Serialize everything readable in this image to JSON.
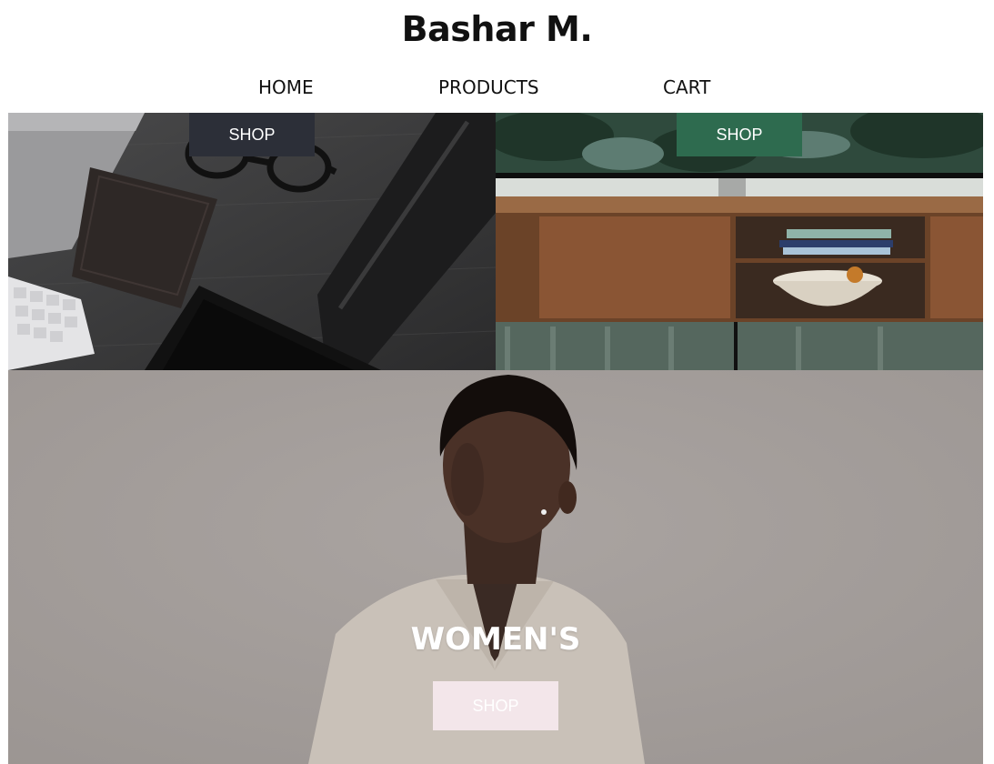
{
  "brand": {
    "name": "Bashar M."
  },
  "nav": {
    "items": [
      "HOME",
      "PRODUCTS",
      "CART"
    ]
  },
  "tiles": {
    "accessories": {
      "button": "SHOP",
      "button_color": "#2c2f38"
    },
    "home": {
      "button": "SHOP",
      "button_color": "#2e6b4f"
    },
    "women": {
      "title": "WOMEN'S",
      "button": "SHOP",
      "button_color": "#f3e6ea"
    }
  },
  "colors": {
    "page_background": "#ffffff",
    "text": "#111111"
  }
}
